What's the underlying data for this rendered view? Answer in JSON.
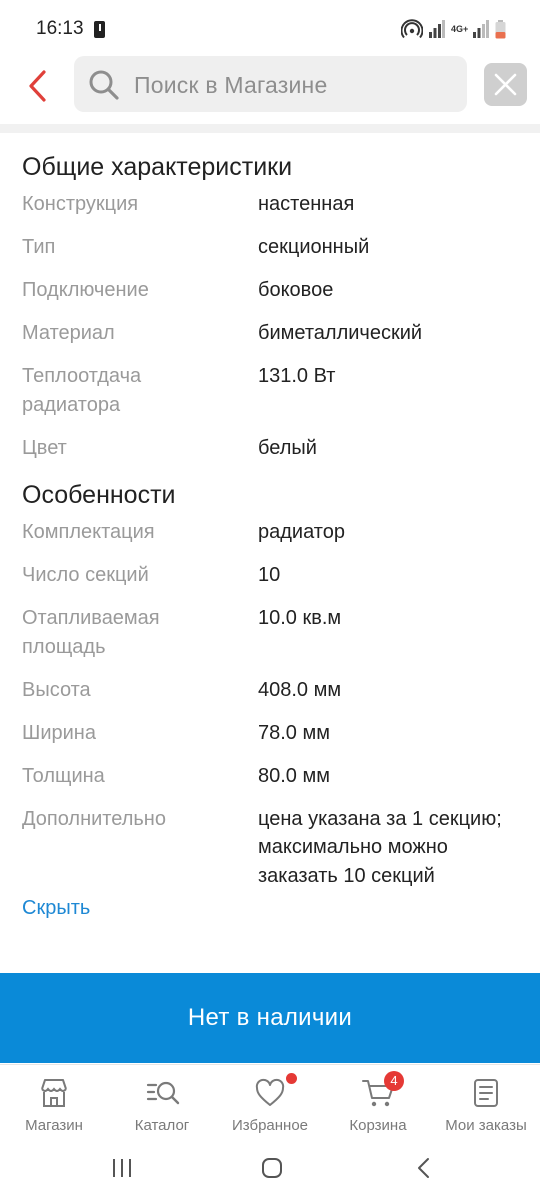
{
  "status_bar": {
    "time": "16:13",
    "network": "4G+"
  },
  "header": {
    "search_placeholder": "Поиск в Магазине"
  },
  "sections": [
    {
      "title": "Общие характеристики",
      "rows": [
        {
          "label": "Конструкция",
          "value": "настенная"
        },
        {
          "label": "Тип",
          "value": "секционный"
        },
        {
          "label": "Подключение",
          "value": "боковое"
        },
        {
          "label": "Материал",
          "value": "биметаллический"
        },
        {
          "label": "Теплоотдача радиатора",
          "value": "131.0 Вт"
        },
        {
          "label": "Цвет",
          "value": "белый"
        }
      ]
    },
    {
      "title": "Особенности",
      "rows": [
        {
          "label": "Комплектация",
          "value": "радиатор"
        },
        {
          "label": "Число секций",
          "value": "10"
        },
        {
          "label": "Отапливаемая площадь",
          "value": "10.0 кв.м"
        },
        {
          "label": "Высота",
          "value": "408.0 мм"
        },
        {
          "label": "Ширина",
          "value": "78.0 мм"
        },
        {
          "label": "Толщина",
          "value": "80.0 мм"
        },
        {
          "label": "Дополнительно",
          "value": "цена указана за 1 секцию; максимально можно заказать 10 секций"
        }
      ]
    }
  ],
  "hide_link": "Скрыть",
  "cta_label": "Нет в наличии",
  "bottom_nav": [
    {
      "label": "Магазин",
      "icon": "store-icon"
    },
    {
      "label": "Каталог",
      "icon": "catalog-search-icon"
    },
    {
      "label": "Избранное",
      "icon": "heart-icon"
    },
    {
      "label": "Корзина",
      "icon": "cart-icon",
      "badge": "4"
    },
    {
      "label": "Мои заказы",
      "icon": "orders-icon"
    }
  ],
  "colors": {
    "accent": "#0a8ad8",
    "link": "#1e88d4",
    "back_arrow": "#e0403a",
    "badge": "#e53935"
  }
}
